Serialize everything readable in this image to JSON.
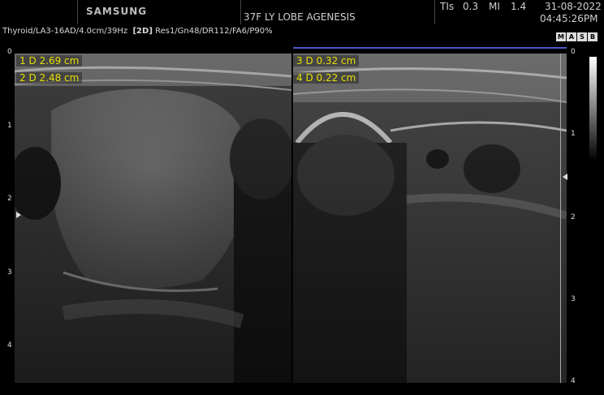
{
  "header": {
    "brand": "SAMSUNG",
    "patient_note": "37F LY LOBE AGENESIS",
    "tis_label": "TIs",
    "tis_value": "0.3",
    "mi_label": "MI",
    "mi_value": "1.4",
    "date": "31-08-2022",
    "time": "04:45:26PM"
  },
  "params": {
    "preset": "Thyroid/LA3-16AD/4.0cm/39Hz",
    "mode": "[2D]",
    "settings": "Res1/Gn48/DR112/FA6/P90%"
  },
  "status_icons": [
    "M",
    "A",
    "S",
    "B"
  ],
  "measurements": [
    {
      "label": "1 D 2.69 cm"
    },
    {
      "label": "2 D 2.48 cm"
    },
    {
      "label": "3 D 0.32 cm"
    },
    {
      "label": "4 D 0.22 cm"
    }
  ],
  "left_scale": [
    "0",
    "1",
    "2",
    "3",
    "4"
  ],
  "right_scale": [
    "0",
    "1",
    "2",
    "3",
    "4"
  ]
}
